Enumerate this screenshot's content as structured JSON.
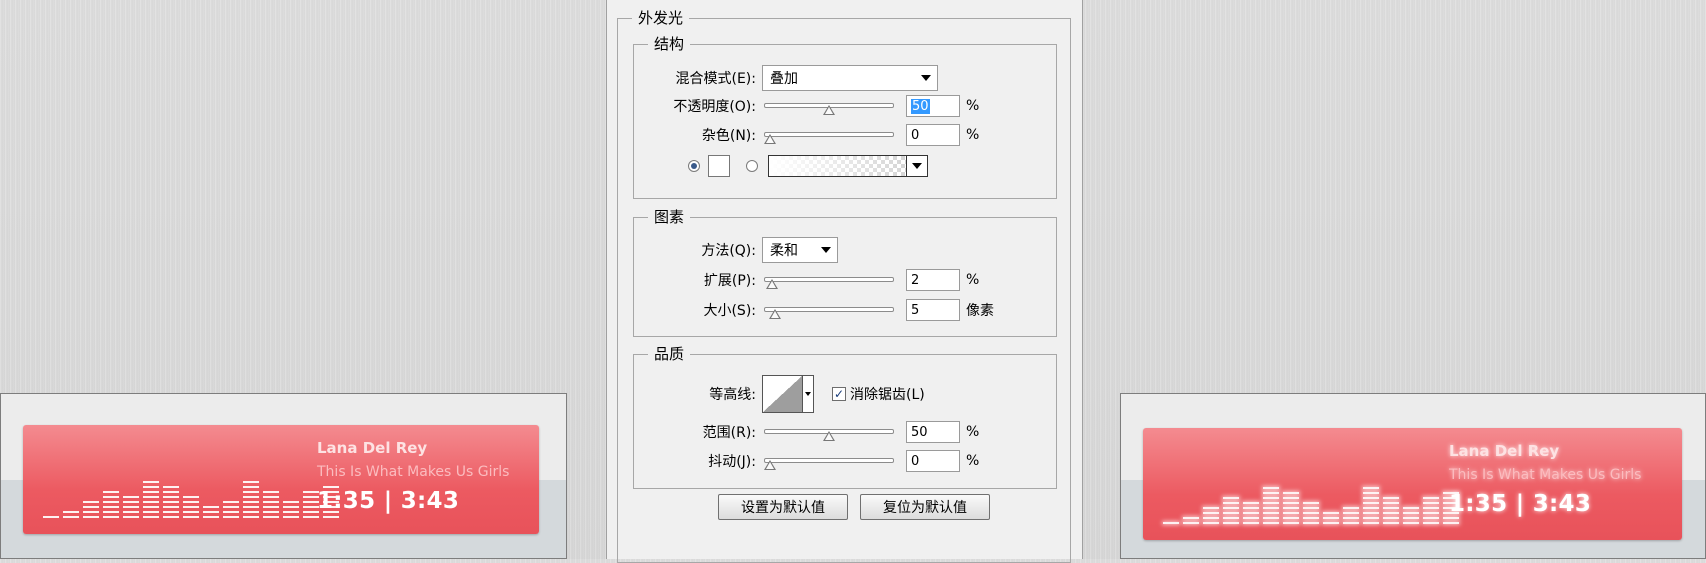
{
  "dialog": {
    "section_title": "外发光",
    "structure": {
      "legend": "结构",
      "blend_mode_label": "混合模式(E):",
      "blend_mode_value": "叠加",
      "opacity_label": "不透明度(O):",
      "opacity_value": "50",
      "opacity_unit": "%",
      "noise_label": "杂色(N):",
      "noise_value": "0",
      "noise_unit": "%",
      "opacity_pct": 50,
      "noise_pct": 0
    },
    "elements": {
      "legend": "图素",
      "technique_label": "方法(Q):",
      "technique_value": "柔和",
      "spread_label": "扩展(P):",
      "spread_value": "2",
      "spread_unit": "%",
      "size_label": "大小(S):",
      "size_value": "5",
      "size_unit": "像素",
      "spread_pct": 2,
      "size_pct": 4
    },
    "quality": {
      "legend": "品质",
      "contour_label": "等高线:",
      "antialias_label": "消除锯齿(L)",
      "antialias_checked": true,
      "range_label": "范围(R):",
      "range_value": "50",
      "range_unit": "%",
      "jitter_label": "抖动(J):",
      "jitter_value": "0",
      "jitter_unit": "%",
      "range_pct": 50,
      "jitter_pct": 0
    },
    "buttons": {
      "make_default": "设置为默认值",
      "reset_default": "复位为默认值"
    }
  },
  "players": [
    {
      "artist": "Lana Del Rey",
      "song": "This Is What Makes Us Girls",
      "time": "1:35 | 3:43"
    },
    {
      "artist": "Lana Del Rey",
      "song": "This Is What Makes Us Girls",
      "time": "1:35 | 3:43"
    }
  ],
  "equalizer_levels": [
    1,
    2,
    4,
    6,
    5,
    8,
    7,
    5,
    3,
    4,
    8,
    6,
    4,
    6,
    7
  ],
  "colors": {
    "player_top": "#f48b90",
    "player_bottom": "#e8525a",
    "selection": "#3399ff"
  }
}
